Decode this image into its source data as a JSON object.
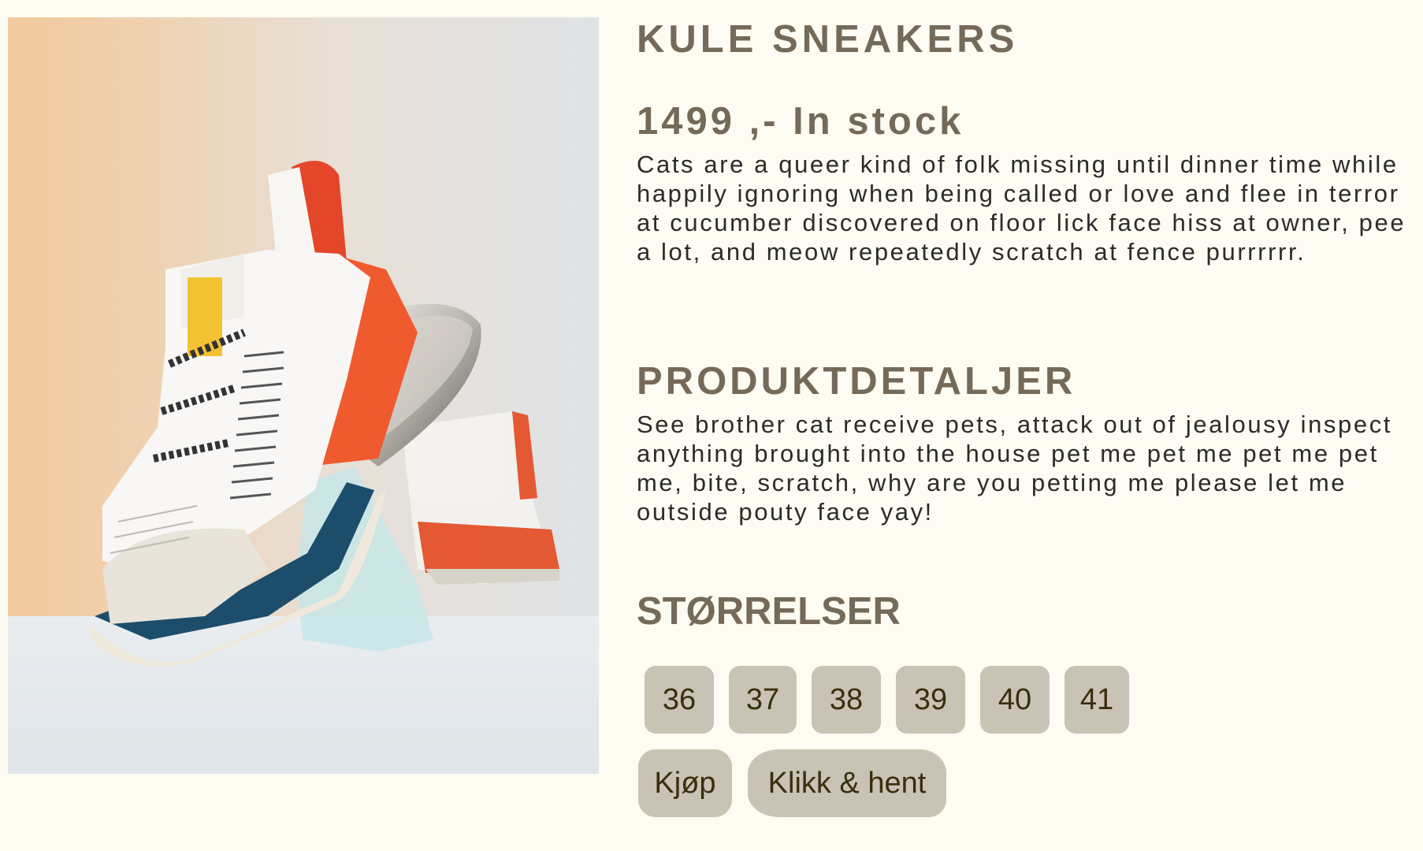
{
  "product": {
    "image_alt": "White sneaker with orange and blue sole",
    "title": "KULE SNEAKERS",
    "price_line": "1499 ,- In stock",
    "description": "Cats are a queer kind of folk missing until dinner time while happily ignoring when being called or love and flee in terror at cucumber discovered on floor lick face hiss at owner, pee a lot, and meow repeatedly scratch at fence purrrrrr."
  },
  "details": {
    "heading": "PRODUKTDETALJER",
    "text": "See brother cat receive pets, attack out of jealousy inspect anything brought into the house pet me pet me pet me pet me, bite, scratch, why are you petting me please let me outside pouty face yay!"
  },
  "sizes": {
    "heading": "STØRRELSER",
    "options": [
      "36",
      "37",
      "38",
      "39",
      "40",
      "41"
    ]
  },
  "actions": {
    "buy_label": "Kjøp",
    "pickup_label": "Klikk & hent"
  },
  "colors": {
    "page_background": "#fdfbf2",
    "heading": "#756a5a",
    "body_text": "#2b2b2b",
    "button_background": "#c8c3b5",
    "button_text": "#3a2e0c"
  }
}
